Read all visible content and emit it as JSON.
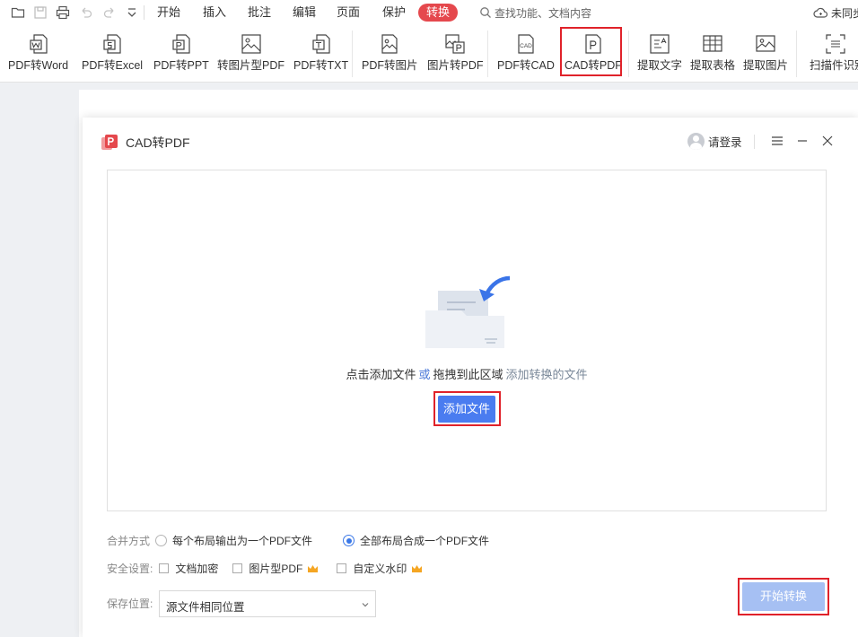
{
  "menubar": {
    "tabs": [
      "开始",
      "插入",
      "批注",
      "编辑",
      "页面",
      "保护"
    ],
    "active_tab": "转换",
    "search_placeholder": "查找功能、文档内容",
    "sync_status": "未同步",
    "accent": "#e5484d"
  },
  "ribbon": {
    "tools": [
      {
        "label": "PDF转Word",
        "icon": "pdf-to-word-icon"
      },
      {
        "label": "PDF转Excel",
        "icon": "pdf-to-excel-icon"
      },
      {
        "label": "PDF转PPT",
        "icon": "pdf-to-ppt-icon"
      },
      {
        "label": "转图片型PDF",
        "icon": "to-image-pdf-icon"
      },
      {
        "label": "PDF转TXT",
        "icon": "pdf-to-txt-icon"
      },
      {
        "label": "PDF转图片",
        "icon": "pdf-to-image-icon"
      },
      {
        "label": "图片转PDF",
        "icon": "image-to-pdf-icon"
      },
      {
        "label": "PDF转CAD",
        "icon": "pdf-to-cad-icon"
      },
      {
        "label": "CAD转PDF",
        "icon": "cad-to-pdf-icon"
      },
      {
        "label": "提取文字",
        "icon": "extract-text-icon"
      },
      {
        "label": "提取表格",
        "icon": "extract-table-icon"
      },
      {
        "label": "提取图片",
        "icon": "extract-image-icon"
      },
      {
        "label": "扫描件识别",
        "icon": "scan-recognize-icon"
      }
    ]
  },
  "dialog": {
    "title": "CAD转PDF",
    "login_label": "请登录",
    "drop_text_main": "点击添加文件",
    "drop_text_or": "或",
    "drop_text_drag": "拖拽到此区域",
    "drop_text_hint": "添加转换的文件",
    "add_button": "添加文件",
    "merge_label": "合并方式",
    "merge_options": [
      "每个布局输出为一个PDF文件",
      "全部布局合成一个PDF文件"
    ],
    "merge_selected": 1,
    "security_label": "安全设置:",
    "security_options": [
      "文档加密",
      "图片型PDF",
      "自定义水印"
    ],
    "save_label": "保存位置:",
    "save_value": "源文件相同位置",
    "start_button": "开始转换",
    "primary_color": "#4a7cf0",
    "disabled_color": "#a6c0f3"
  }
}
